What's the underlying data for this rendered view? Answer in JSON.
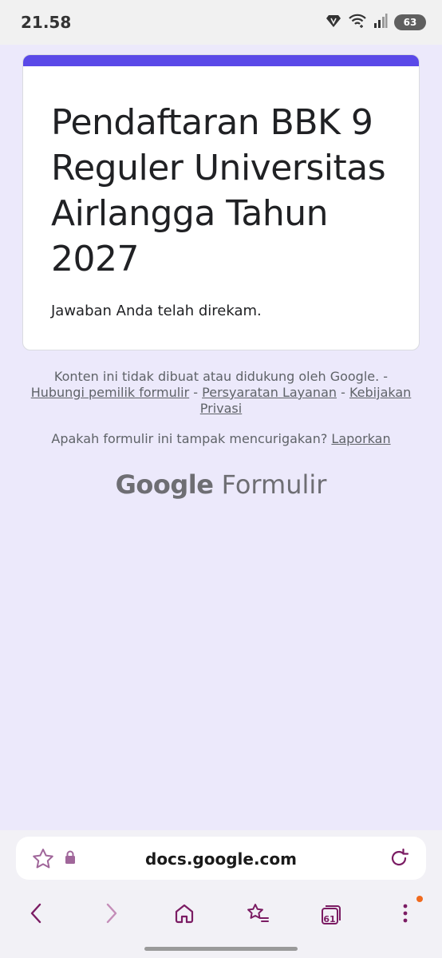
{
  "status_bar": {
    "time": "21.58",
    "battery": "63",
    "icons": [
      "vpn-diamond-icon",
      "wifi-icon",
      "signal-icon",
      "battery-icon"
    ]
  },
  "form": {
    "title": "Pendaftaran BBK 9 Reguler Universitas Airlangga Tahun 2027",
    "confirmation": "Jawaban Anda telah direkam.",
    "accent_color": "#5A49E8"
  },
  "footer": {
    "disclaimer": "Konten ini tidak dibuat atau didukung oleh Google.",
    "separator": "-",
    "links": {
      "contact_owner": "Hubungi pemilik formulir",
      "terms": "Persyaratan Layanan",
      "privacy": "Kebijakan Privasi"
    },
    "report_question": "Apakah formulir ini tampak mencurigakan?",
    "report_link": "Laporkan"
  },
  "branding": {
    "google": "Google",
    "product": "Formulir"
  },
  "browser": {
    "url": "docs.google.com",
    "tab_count": "61",
    "accent_color": "#7B1C63"
  }
}
